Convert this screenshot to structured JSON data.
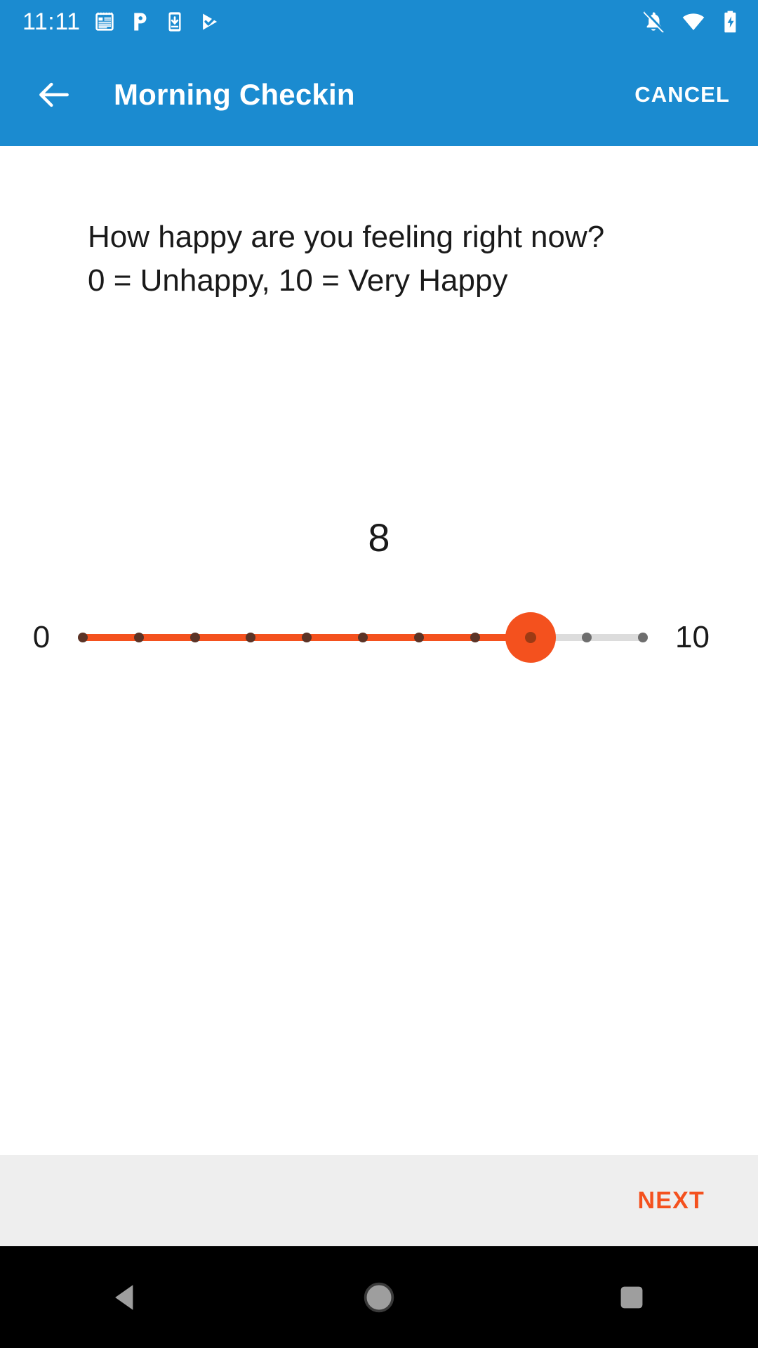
{
  "status_bar": {
    "clock": "11:11",
    "left_icons": [
      {
        "name": "notepad-icon",
        "label": "notepad"
      },
      {
        "name": "pandora-p-icon",
        "label": "P"
      },
      {
        "name": "phone-download-icon",
        "label": "phone download"
      },
      {
        "name": "play-protect-check-icon",
        "label": "play protect"
      }
    ],
    "right_icons": [
      {
        "name": "notifications-muted-icon",
        "label": "notifications off"
      },
      {
        "name": "wifi-icon",
        "label": "wifi"
      },
      {
        "name": "battery-charging-icon",
        "label": "battery charging"
      }
    ]
  },
  "app_bar": {
    "back_label": "back",
    "title": "Morning Checkin",
    "cancel_label": "CANCEL"
  },
  "survey": {
    "question_line1": "How happy are you feeling right now?",
    "question_line2": "0 = Unhappy, 10 = Very Happy",
    "question_text": "How happy are you feeling right now? 0 = Unhappy, 10 = Very Happy"
  },
  "slider": {
    "value": 8,
    "value_display": "8",
    "min": 0,
    "max": 10,
    "min_label": "0",
    "max_label": "10",
    "step": 1,
    "tick_count": 11,
    "active_color": "#F4511E",
    "track_color": "#DCDCDC",
    "tick_on_color": "#5B3326",
    "tick_off_color": "#6E6E6E"
  },
  "action_bar": {
    "next_label": "NEXT",
    "background": "#EEEEEE",
    "accent": "#F4511E"
  },
  "nav_bar": {
    "buttons": [
      {
        "name": "nav-back-button",
        "label": "back"
      },
      {
        "name": "nav-home-button",
        "label": "home"
      },
      {
        "name": "nav-recents-button",
        "label": "recents"
      }
    ]
  },
  "theme": {
    "primary": "#1B8BD0",
    "accent": "#F4511E",
    "text": "#1A1A1A",
    "background": "#FFFFFF"
  }
}
